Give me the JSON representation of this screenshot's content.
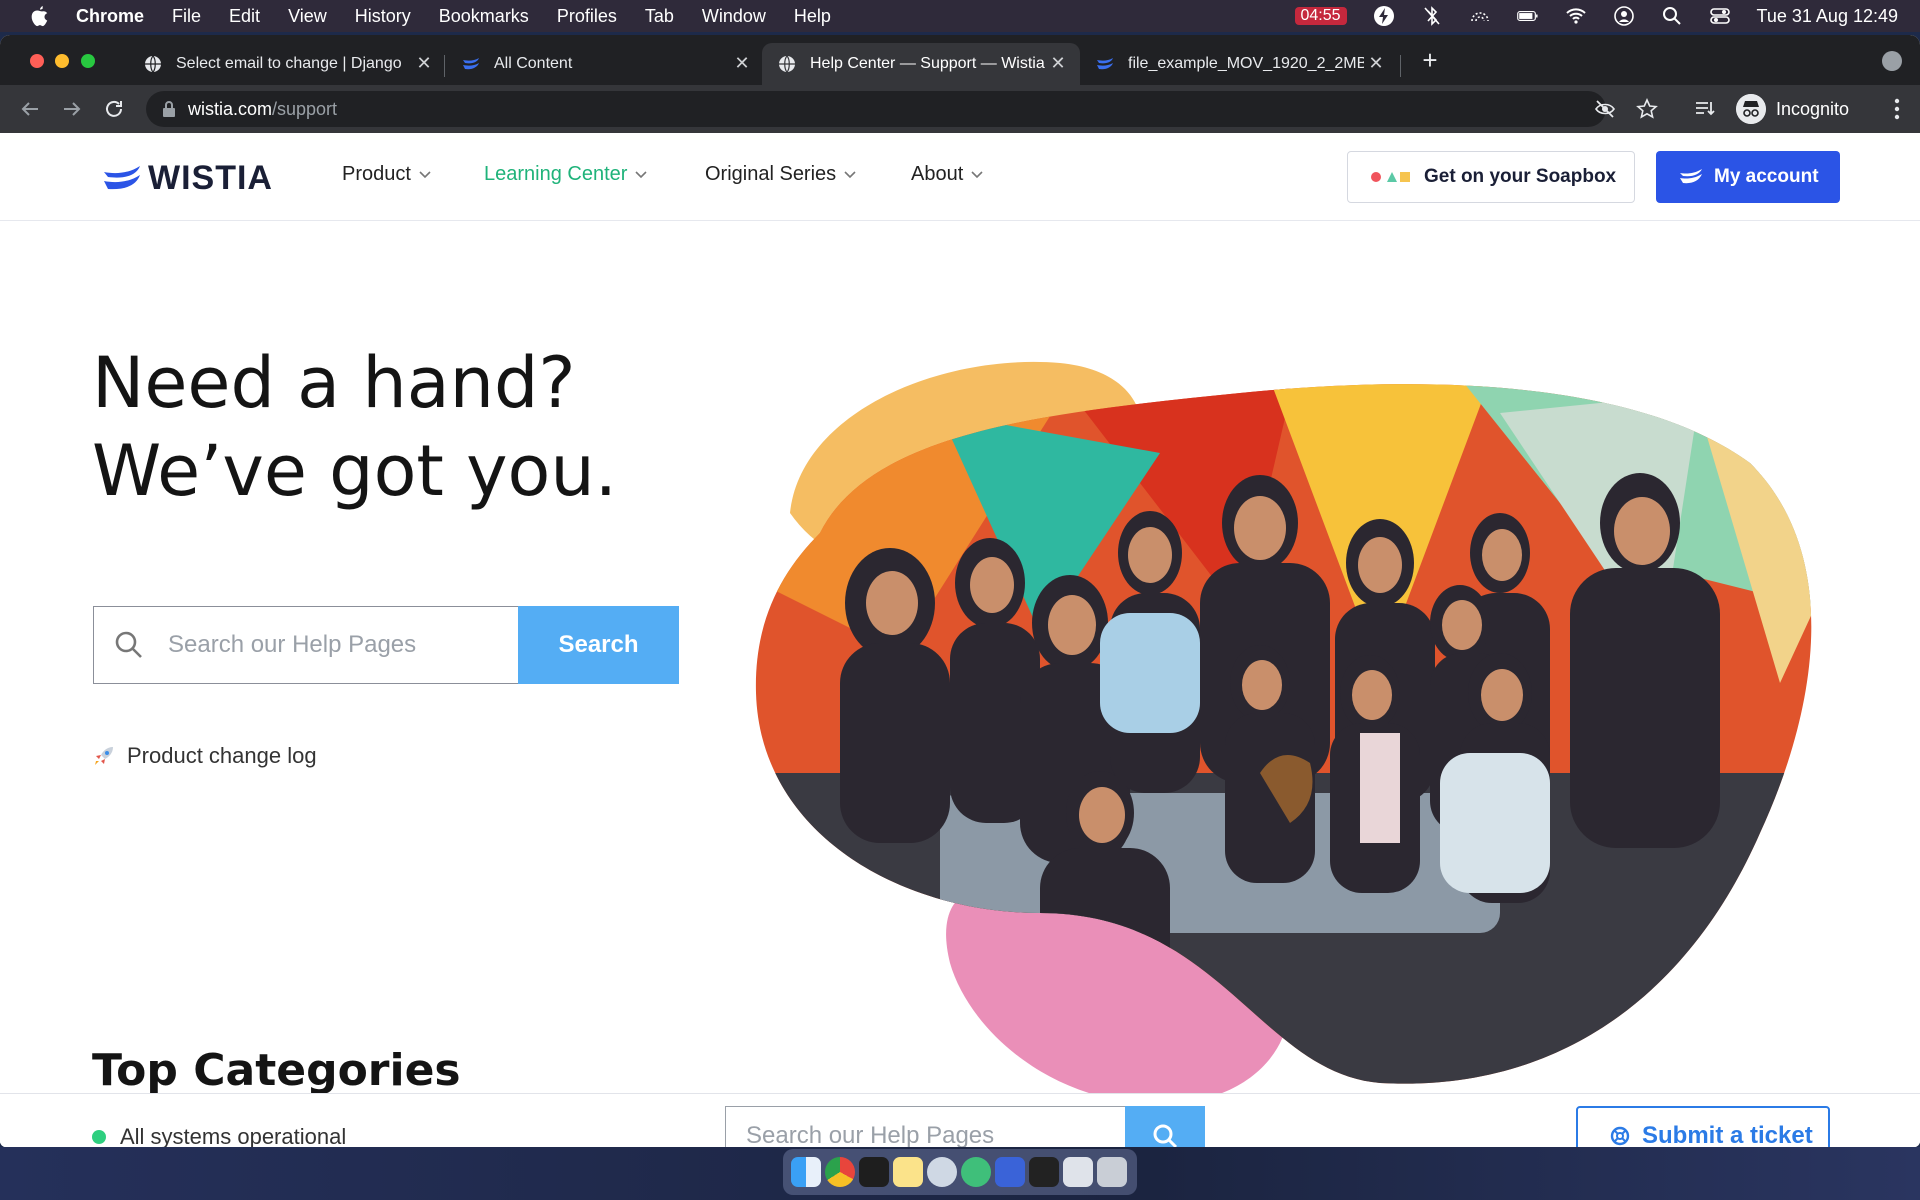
{
  "menubar": {
    "app": "Chrome",
    "items": [
      "File",
      "Edit",
      "View",
      "History",
      "Bookmarks",
      "Profiles",
      "Tab",
      "Window",
      "Help"
    ],
    "recording_timer": "04:55",
    "datetime": "Tue 31 Aug  12:49"
  },
  "tabs": [
    {
      "title": "Select email to change | Django",
      "favicon": "globe-icon",
      "active": false
    },
    {
      "title": "All Content",
      "favicon": "wistia-icon",
      "active": false
    },
    {
      "title": "Help Center — Support — Wistia",
      "favicon": "globe-icon",
      "active": true
    },
    {
      "title": "file_example_MOV_1920_2_2MB",
      "favicon": "wistia-icon",
      "active": false
    }
  ],
  "omnibox": {
    "host": "wistia.com",
    "path": "/support"
  },
  "profile": {
    "label": "Incognito"
  },
  "site": {
    "logo": "WISTIA",
    "nav": [
      {
        "label": "Product",
        "active": false
      },
      {
        "label": "Learning Center",
        "active": true
      },
      {
        "label": "Original Series",
        "active": false
      },
      {
        "label": "About",
        "active": false
      }
    ],
    "soapbox_label": "Get on your Soapbox",
    "account_label": "My account"
  },
  "hero": {
    "title_line1": "Need a hand?",
    "title_line2": "We’ve got you.",
    "search_placeholder": "Search our Help Pages",
    "search_button": "Search",
    "changelog": "Product change log",
    "section_heading": "Top Categories"
  },
  "footer_bar": {
    "status": "All systems operational",
    "search_placeholder": "Search our Help Pages",
    "ticket_label": "Submit a ticket"
  },
  "colors": {
    "accent_blue": "#2b54e6",
    "search_blue": "#54adf4",
    "nav_active_green": "#1fb37a",
    "status_green": "#2ecf7f",
    "blob_orange": "#f5bd62",
    "blob_pink": "#ea8fb8"
  }
}
